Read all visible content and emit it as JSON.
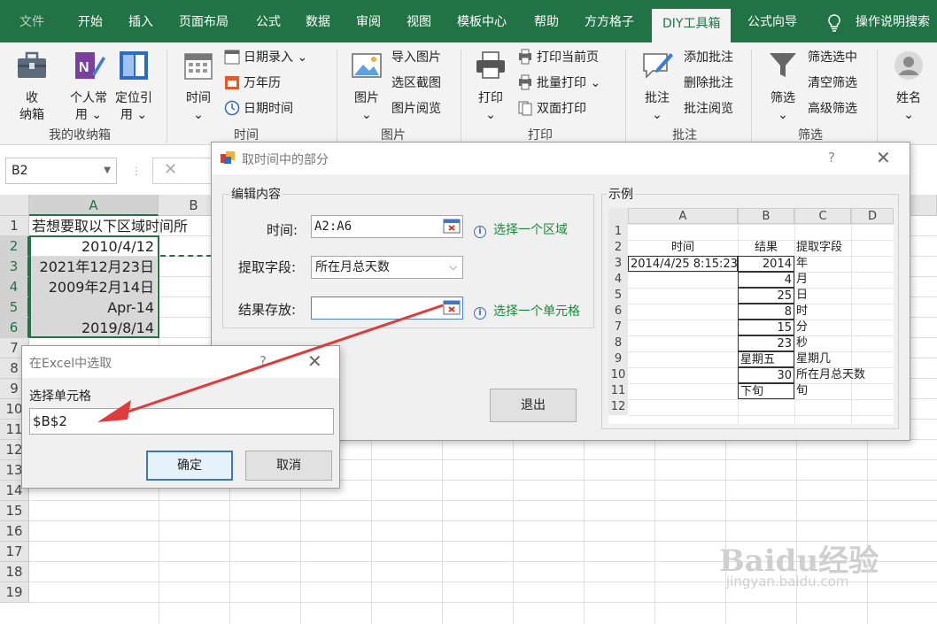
{
  "ribbon_tabs": [
    "文件",
    "开始",
    "插入",
    "页面布局",
    "公式",
    "数据",
    "审阅",
    "视图",
    "模板中心",
    "帮助",
    "方方格子",
    "DIY工具箱",
    "公式向导",
    "操作说明搜索"
  ],
  "ribbon_groups": {
    "storage": {
      "label": "我的收纳箱",
      "buttons": [
        "收\n纳箱",
        "个人常\n用 ⌄",
        "定位引\n用 ⌄"
      ]
    },
    "time": {
      "label": "时间",
      "big": "时间\n⌄",
      "small": [
        "日期录入 ⌄",
        "万年历",
        "日期时间"
      ]
    },
    "image": {
      "label": "图片",
      "big": "图片\n⌄",
      "small": [
        "导入图片",
        "选区截图",
        "图片阅览"
      ]
    },
    "print": {
      "label": "打印",
      "big": "打印\n⌄",
      "small": [
        "打印当前页",
        "批量打印 ⌄",
        "双面打印"
      ]
    },
    "comment": {
      "label": "批注",
      "big": "批注\n⌄",
      "small": [
        "添加批注",
        "删除批注",
        "批注阅览"
      ]
    },
    "filter": {
      "label": "筛选",
      "big": "筛选\n⌄",
      "small": [
        "筛选选中",
        "清空筛选",
        "高级筛选"
      ]
    },
    "name": {
      "big": "姓名\n⌄"
    }
  },
  "name_box": "B2",
  "sheet": {
    "columns": [
      "A",
      "B"
    ],
    "rows": [
      "1",
      "2",
      "3",
      "4",
      "5",
      "6",
      "7",
      "8",
      "9",
      "10",
      "11",
      "12",
      "13",
      "14",
      "15",
      "16",
      "17",
      "18",
      "19"
    ],
    "a1": "若想要取以下区域时间所",
    "a_values": [
      "2010/4/12",
      "2021年12月23日",
      "2009年2月14日",
      "Apr-14",
      "2019/8/14"
    ]
  },
  "main_dialog": {
    "title": "取时间中的部分",
    "help": "?",
    "close": "✕",
    "group_edit": "编辑内容",
    "time_label": "时间:",
    "time_value": "A2:A6",
    "time_hint": "选择一个区域",
    "field_label": "提取字段:",
    "field_value": "所在月总天数",
    "result_label": "结果存放:",
    "result_value": "",
    "result_hint": "选择一个单元格",
    "exit_button": "退出",
    "example_label": "示例"
  },
  "example_sheet": {
    "cols": [
      "A",
      "B",
      "C",
      "D"
    ],
    "rows": [
      "1",
      "2",
      "3",
      "4",
      "5",
      "6",
      "7",
      "8",
      "9",
      "10",
      "11",
      "12"
    ],
    "headers": [
      "时间",
      "结果",
      "提取字段"
    ],
    "time": "2014/4/25 8:15:23",
    "results": [
      "2014",
      "4",
      "25",
      "8",
      "15",
      "23",
      "星期五",
      "30",
      "下旬"
    ],
    "fields": [
      "年",
      "月",
      "日",
      "时",
      "分",
      "秒",
      "星期几",
      "所在月总天数",
      "旬"
    ]
  },
  "pick_dialog": {
    "title": "在Excel中选取",
    "help": "?",
    "close": "✕",
    "label": "选择单元格",
    "value": "$B$2",
    "ok": "确定",
    "cancel": "取消"
  },
  "watermark": {
    "main": "Baidu经验",
    "sub": "jingyan.baidu.com"
  },
  "colors": {
    "excel_green": "#217346",
    "hint_green": "#1a8a3a",
    "arrow_red": "#e03a3a"
  }
}
